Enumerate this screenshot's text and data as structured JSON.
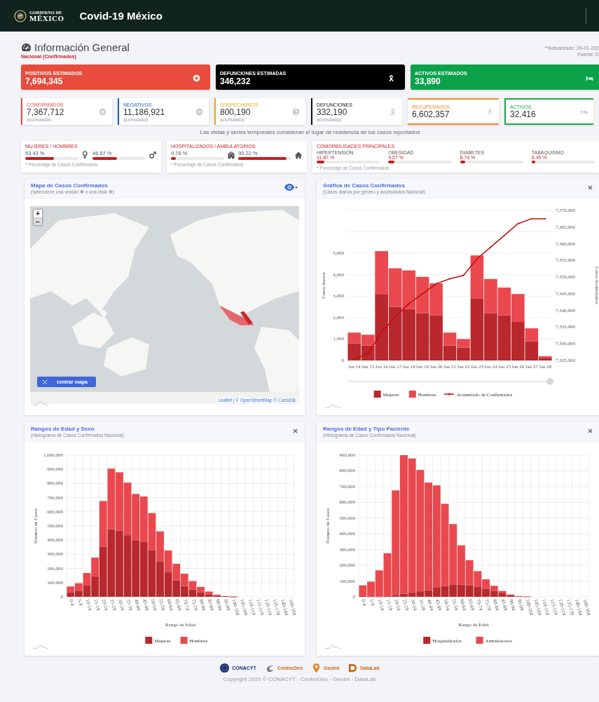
{
  "header": {
    "logo_caption": "GOBIERNO DE",
    "logo_wordmark": "MÉXICO",
    "title": "Covid-19 México"
  },
  "overview": {
    "title": "Información General",
    "subtitle": "Nacional (Confirmados)",
    "updated": "**Actualizado: 29-01-202",
    "source": "Fuente: D"
  },
  "estimates": [
    {
      "label": "POSITIVOS ESTIMADOS",
      "value": "7,694,345",
      "color": "#e74c3c"
    },
    {
      "label": "DEFUNCIONES ESTIMADAS",
      "value": "346,232",
      "color": "#000000"
    },
    {
      "label": "ACTIVOS ESTIMADOS",
      "value": "33,890",
      "color": "#0ca24a"
    }
  ],
  "counters": [
    {
      "label": "CONFIRMADOS",
      "value": "7,367,712",
      "note": "acumulados",
      "color": "#e74c3c",
      "kind": "side"
    },
    {
      "label": "NEGATIVOS",
      "value": "11,186,921",
      "note": "acumulados",
      "color": "#1f5fb5",
      "kind": "side"
    },
    {
      "label": "SOSPECHOSOS",
      "value": "800,190",
      "note": "acumulados",
      "color": "#e0aa10",
      "kind": "side"
    },
    {
      "label": "DEFUNCIONES",
      "value": "332,190",
      "note": "acumulados",
      "color": "#111111",
      "kind": "side"
    },
    {
      "label": "RECUPERADOS",
      "value": "6,602,357",
      "color": "#f08a24",
      "kind": "band"
    },
    {
      "label": "ACTIVOS",
      "value": "32,416",
      "color": "#1ea84a",
      "kind": "band"
    }
  ],
  "note": "Las vistas y series temporales consideran el lugar de residencia de los casos reportados",
  "ratios": [
    {
      "title": "MUJERES / HOMBRES",
      "items": [
        {
          "value": "53.43 %",
          "level": 0.5343
        },
        {
          "value": "46.57 %",
          "level": 0.4657
        }
      ],
      "footnote": "* Porcentaje de Casos Confirmados"
    },
    {
      "title": "HOSPITALIZADOS / AMBULATORIOS",
      "items": [
        {
          "value": "9.78 %",
          "level": 0.0978
        },
        {
          "value": "90.22 %",
          "level": 0.9022
        }
      ],
      "footnote": "* Porcentaje de Casos Confirmados"
    }
  ],
  "comorbidities": {
    "title": "COMORBILIDADES PRINCIPALES",
    "items": [
      {
        "label": "HIPERTENSION",
        "value": "11.87 %",
        "level": 0.1187
      },
      {
        "label": "OBESIDAD",
        "value": "9.57 %",
        "level": 0.0957
      },
      {
        "label": "DIABETES",
        "value": "8.74 %",
        "level": 0.0874
      },
      {
        "label": "TABAQUISMO",
        "value": "5.45 %",
        "level": 0.0545
      }
    ],
    "footnote": "* Porcentaje de Casos Confirmados"
  },
  "panels": [
    {
      "kind": "map",
      "title": "Mapa de Casos Confirmados",
      "subtitle": "(Seleccione una unidad ✥ o una vista ✥)",
      "zoom_in": "+",
      "zoom_out": "−",
      "center_button": "centrar mapa",
      "attribution": "Leaflet | © OpenStreetMap © CartoDB"
    },
    {
      "kind": "chart",
      "title": "Gráfica de Casos Confirmados",
      "subtitle": "(Casos diarios por género y acumulados Nacional)",
      "layers": [
        {
          "chart_data": {
            "type": "bar",
            "stacked": true,
            "grid": true,
            "legend": "bottom",
            "ylabel": "Casos diarios",
            "ylim": [
              0,
              7000
            ],
            "yticks": [
              {
                "value": 0,
                "label": "0"
              },
              {
                "value": 1000,
                "label": "1,000"
              },
              {
                "value": 2000,
                "label": "2,000"
              },
              {
                "value": 3000,
                "label": "3,000"
              },
              {
                "value": 4000,
                "label": "4,000"
              },
              {
                "value": 5000,
                "label": "5,000"
              }
            ],
            "categories": [
              "Jan 14",
              "Jan 15",
              "Jan 16",
              "Jan 17",
              "Jan 18",
              "Jan 19",
              "Jan 20",
              "Jan 21",
              "Jan 22",
              "Jan 23",
              "Jan 24",
              "Jan 25",
              "Jan 26",
              "Jan 27",
              "Jan 28"
            ],
            "series": [
              {
                "name": "Mujeres",
                "color": "#b8282d",
                "values": [
                  800,
                  700,
                  3100,
                  2500,
                  2400,
                  2200,
                  2100,
                  700,
                  600,
                  2900,
                  2200,
                  2100,
                  1800,
                  900,
                  100
                ]
              },
              {
                "name": "Hombres",
                "color": "#e9484e",
                "values": [
                  500,
                  500,
                  2000,
                  1800,
                  1800,
                  1700,
                  1500,
                  600,
                  400,
                  2000,
                  1600,
                  1300,
                  1300,
                  600,
                  100
                ]
              }
            ]
          }
        },
        {
          "chart_data": {
            "type": "line",
            "legend": "bottom",
            "ylabel": "Casos Acumulados",
            "ylim": [
              7325000,
              7370000
            ],
            "yticks": [
              {
                "value": 7325000,
                "label": "7,325,000"
              },
              {
                "value": 7330000,
                "label": "7,330,000"
              },
              {
                "value": 7335000,
                "label": "7,335,000"
              },
              {
                "value": 7340000,
                "label": "7,340,000"
              },
              {
                "value": 7345000,
                "label": "7,345,000"
              },
              {
                "value": 7350000,
                "label": "7,350,000"
              },
              {
                "value": 7355000,
                "label": "7,355,000"
              },
              {
                "value": 7360000,
                "label": "7,360,000"
              },
              {
                "value": 7365000,
                "label": "7,365,000"
              },
              {
                "value": 7370000,
                "label": "7,370,000"
              }
            ],
            "series": [
              {
                "name": "Acumulado de Confirmados",
                "color": "#cc0a0a",
                "values": [
                  7325500,
                  7327000,
                  7333500,
                  7338000,
                  7342000,
                  7345000,
                  7348000,
                  7349500,
                  7350500,
                  7355500,
                  7359000,
                  7362500,
                  7366000,
                  7367500,
                  7367500
                ]
              }
            ]
          }
        }
      ]
    },
    {
      "kind": "chart",
      "title": "Rangos de Edad y Sexo",
      "subtitle": "(Histograma de Casos Confirmados Nacional)",
      "layers": [
        {
          "chart_data": {
            "type": "bar",
            "stacked": true,
            "grid": true,
            "legend": "bottom",
            "xlabel": "Rango de Edad",
            "ylabel": "Número de Casos",
            "ylim": [
              0,
              1000000
            ],
            "yticks": [
              {
                "value": 0,
                "label": "0"
              },
              {
                "value": 100000,
                "label": "100,000"
              },
              {
                "value": 200000,
                "label": "200,000"
              },
              {
                "value": 300000,
                "label": "300,000"
              },
              {
                "value": 400000,
                "label": "400,000"
              },
              {
                "value": 500000,
                "label": "500,000"
              },
              {
                "value": 600000,
                "label": "600,000"
              },
              {
                "value": 700000,
                "label": "700,000"
              },
              {
                "value": 800000,
                "label": "800,000"
              },
              {
                "value": 900000,
                "label": "900,000"
              },
              {
                "value": 1000000,
                "label": "1,000,000"
              }
            ],
            "categories": [
              "0-4",
              "5-9",
              "10-14",
              "15-19",
              "20-24",
              "25-29",
              "30-34",
              "35-39",
              "40-44",
              "45-49",
              "50-54",
              "55-59",
              "60-64",
              "65-69",
              "70-74",
              "75-79",
              "80-84",
              "85-89",
              "90-94",
              "95-99",
              "100-104",
              "105-109",
              "110-114",
              "115-119",
              "120-124",
              "135-139",
              "140-144",
              "160-164"
            ],
            "series": [
              {
                "name": "Mujeres",
                "color": "#b8282d",
                "values": [
                  32000,
                  43000,
                  83000,
                  143000,
                  355000,
                  478000,
                  468000,
                  435000,
                  400000,
                  390000,
                  327000,
                  248000,
                  173000,
                  116000,
                  76000,
                  51000,
                  33000,
                  18000,
                  8000,
                  5000,
                  2000,
                  0,
                  0,
                  0,
                  0,
                  0,
                  0,
                  0
                ]
              },
              {
                "name": "Hombres",
                "color": "#e9484e",
                "values": [
                  41000,
                  53000,
                  85000,
                  134000,
                  321000,
                  427000,
                  411000,
                  371000,
                  326000,
                  318000,
                  264000,
                  214000,
                  154000,
                  117000,
                  87000,
                  60000,
                  37000,
                  19000,
                  7000,
                  0,
                  0,
                  0,
                  0,
                  0,
                  0,
                  0,
                  0,
                  0
                ]
              }
            ]
          }
        }
      ]
    },
    {
      "kind": "chart",
      "title": "Rangos de Edad y Tipo Paciente",
      "subtitle": "(Histograma de Casos Confirmados Nacional)",
      "layers": [
        {
          "chart_data": {
            "type": "bar",
            "stacked": true,
            "grid": true,
            "legend": "bottom",
            "xlabel": "Rango de Edad",
            "ylabel": "Número de Casos",
            "ylim": [
              0,
              900000
            ],
            "yticks": [
              {
                "value": 0,
                "label": "0"
              },
              {
                "value": 100000,
                "label": "100,000"
              },
              {
                "value": 200000,
                "label": "200,000"
              },
              {
                "value": 300000,
                "label": "300,000"
              },
              {
                "value": 400000,
                "label": "400,000"
              },
              {
                "value": 500000,
                "label": "500,000"
              },
              {
                "value": 600000,
                "label": "600,000"
              },
              {
                "value": 700000,
                "label": "700,000"
              },
              {
                "value": 800000,
                "label": "800,000"
              },
              {
                "value": 900000,
                "label": "900,000"
              }
            ],
            "categories": [
              "0-4",
              "5-9",
              "10-14",
              "15-19",
              "20-24",
              "25-29",
              "30-34",
              "35-39",
              "40-44",
              "45-49",
              "50-54",
              "55-59",
              "60-64",
              "65-69",
              "70-74",
              "75-79",
              "80-84",
              "85-89",
              "90-94",
              "95-99",
              "100-104",
              "105-109",
              "110-114",
              "115-119",
              "120-124",
              "135-139",
              "140-144",
              "160-164"
            ],
            "series": [
              {
                "name": "Hospitalizados",
                "color": "#b8282d",
                "values": [
                  5000,
                  3000,
                  3000,
                  4000,
                  12000,
                  20000,
                  28000,
                  35000,
                  42000,
                  58000,
                  68000,
                  76000,
                  77000,
                  74000,
                  63000,
                  52000,
                  37000,
                  22000,
                  10000,
                  0,
                  0,
                  0,
                  0,
                  0,
                  0,
                  0,
                  0,
                  0
                ]
              },
              {
                "name": "Ambulatorios",
                "color": "#e9484e",
                "values": [
                  68000,
                  93000,
                  165000,
                  273000,
                  664000,
                  880000,
                  851000,
                  771000,
                  684000,
                  650000,
                  523000,
                  386000,
                  250000,
                  159000,
                  100000,
                  59000,
                  33000,
                  15000,
                  5000,
                  5000,
                  2000,
                  0,
                  0,
                  0,
                  0,
                  0,
                  0,
                  0
                ]
              }
            ]
          }
        }
      ]
    }
  ],
  "footer": {
    "logos": [
      "CONACYT",
      "CentroGeo",
      "GeoInt",
      "DataLab"
    ],
    "copyright": "Copyright 2020 © CONACYT - CentroGeo - GeoInt - DataLab"
  }
}
